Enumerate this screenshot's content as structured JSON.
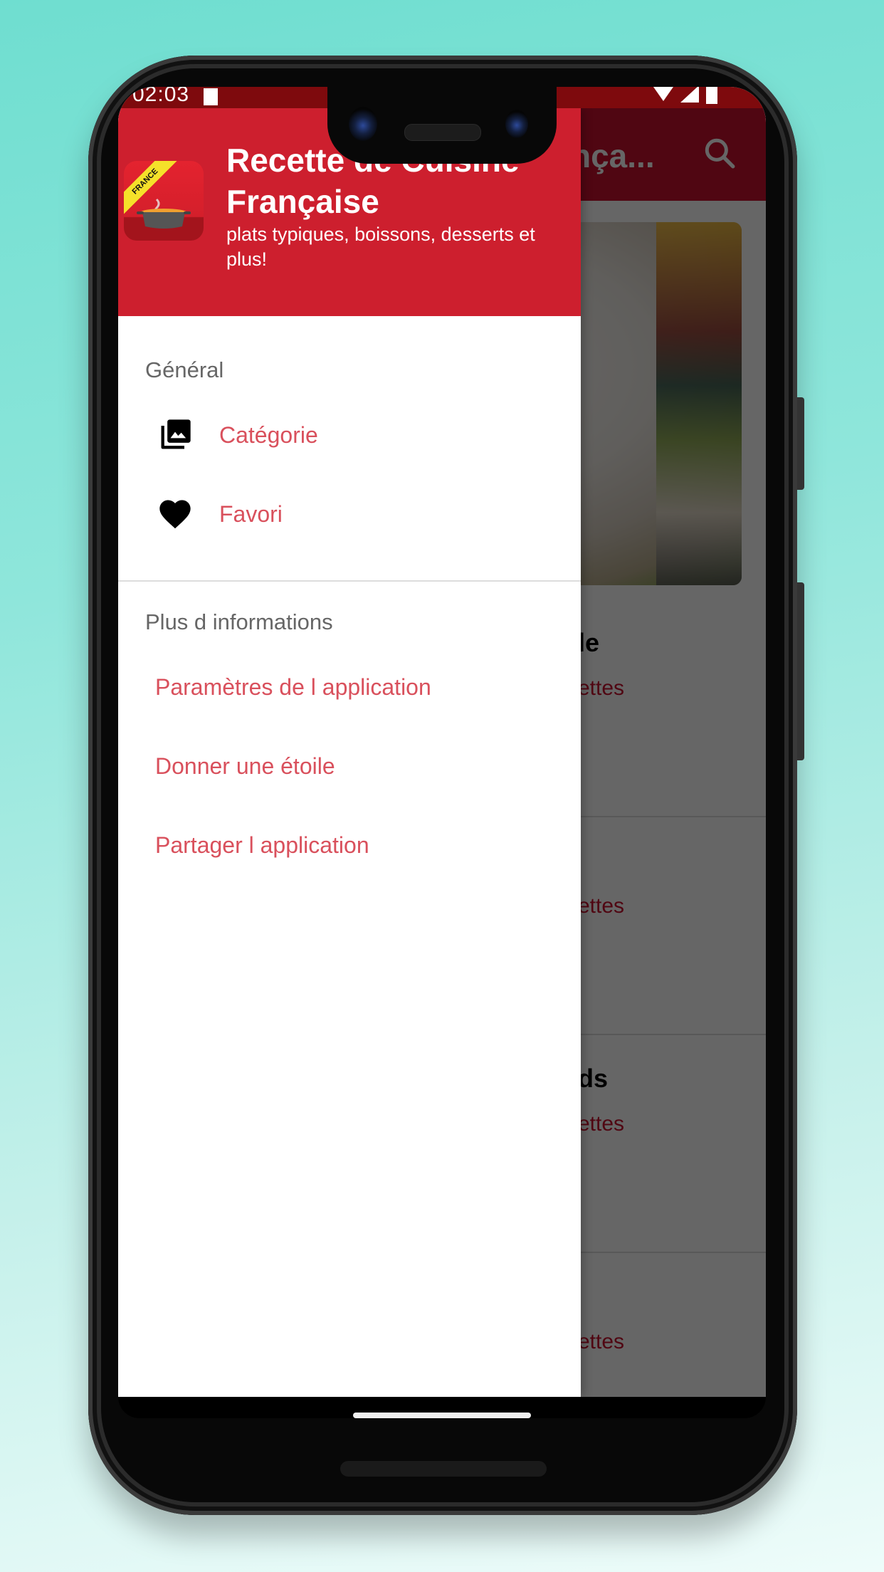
{
  "statusbar": {
    "time": "02:03",
    "icons": [
      "notification-icon",
      "wifi-icon",
      "signal-icon",
      "battery-icon"
    ]
  },
  "background_app": {
    "toolbar_title": "Recette de Cuisine Française",
    "toolbar_title_visible": "nça...",
    "search_icon": "search-icon",
    "list_items": [
      {
        "title_visible": "le",
        "subtitle_visible": "ettes"
      },
      {
        "title_visible": "",
        "subtitle_visible": "ettes"
      },
      {
        "title_visible": "ds",
        "subtitle_visible": "ettes"
      },
      {
        "title_visible": "",
        "subtitle_visible": "ettes"
      }
    ]
  },
  "drawer": {
    "header": {
      "title": "Recette de Cuisine Française",
      "subtitle": "plats typiques, boissons, desserts et plus!",
      "icon_label": "FRANCE"
    },
    "sections": [
      {
        "label": "Général",
        "items": [
          {
            "label": "Catégorie",
            "icon": "photo-library-icon"
          },
          {
            "label": "Favori",
            "icon": "heart-icon"
          }
        ]
      },
      {
        "label": "Plus d informations",
        "items": [
          {
            "label": "Paramètres de l application"
          },
          {
            "label": "Donner une étoile"
          },
          {
            "label": "Partager l application"
          }
        ]
      }
    ]
  },
  "colors": {
    "primary": "#cd1f2e",
    "status_bar": "#7e0a0d",
    "menu_text": "#d9505c",
    "section_text": "#666666",
    "background_gradient_top": "#6fded0"
  }
}
